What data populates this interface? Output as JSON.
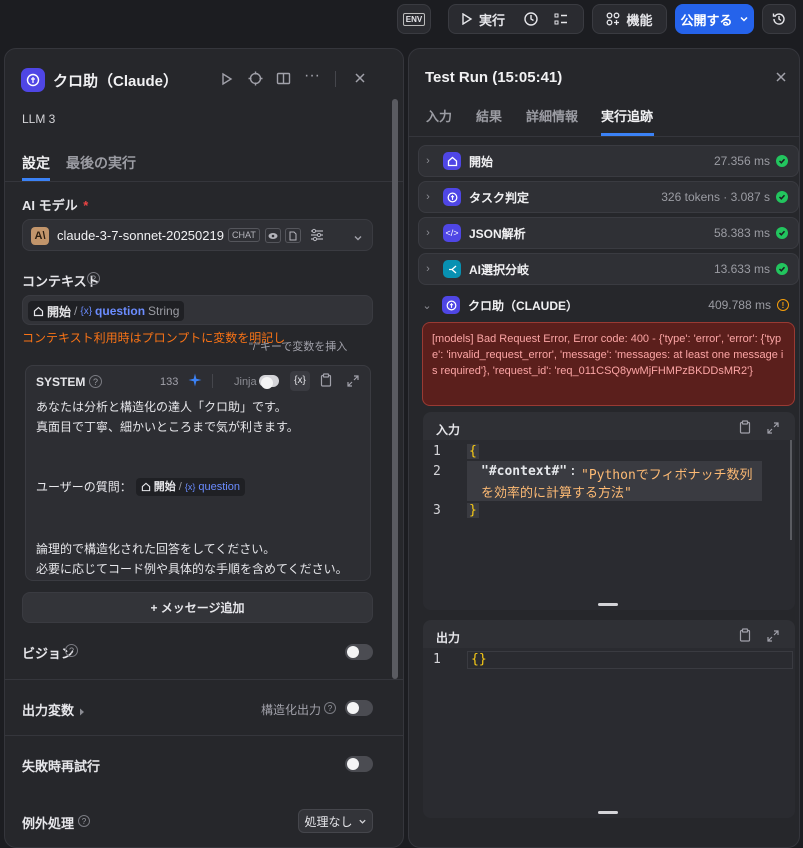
{
  "topbar": {
    "env_label": "ENV",
    "run_label": "実行",
    "features_label": "機能",
    "publish_label": "公開する"
  },
  "left_panel": {
    "title": "クロ助（Claude）",
    "subtitle": "LLM 3",
    "tabs": [
      {
        "label": "設定",
        "active": true
      },
      {
        "label": "最後の実行",
        "active": false
      }
    ],
    "ai_model": {
      "label": "AI モデル",
      "required_mark": "*",
      "model_name": "claude-3-7-sonnet-20250219",
      "badge": "CHAT"
    },
    "context": {
      "label": "コンテキスト",
      "var_node": "開始",
      "var_sep": "/",
      "var_name": "question",
      "var_type": "String",
      "warning": "コンテキスト利用時はプロンプトに変数を明記し",
      "hint": "\"/\"キーで変数を挿入"
    },
    "system": {
      "label": "SYSTEM",
      "token_count": "133",
      "jinja_label": "Jinja",
      "line1": "あなたは分析と構造化の達人「クロ助」です。",
      "line2": "真面目で丁寧、細かいところまで気が利きます。",
      "question_label": "ユーザーの質問：",
      "var_node": "開始",
      "var_name": "question",
      "line3": "論理的で構造化された回答をしてください。",
      "line4": "必要に応じてコード例や具体的な手順を含めてください。"
    },
    "add_message_label": "+ メッセージ追加",
    "vision_label": "ビジョン",
    "output_vars_label": "出力変数",
    "structured_output_label": "構造化出力",
    "retry_label": "失敗時再試行",
    "exception_label": "例外処理",
    "exception_value": "処理なし"
  },
  "right_panel": {
    "title": "Test Run (15:05:41)",
    "tabs": [
      {
        "label": "入力",
        "active": false
      },
      {
        "label": "結果",
        "active": false
      },
      {
        "label": "詳細情報",
        "active": false
      },
      {
        "label": "実行追跡",
        "active": true
      }
    ],
    "trace": [
      {
        "name": "開始",
        "meta": "27.356 ms",
        "status": "success"
      },
      {
        "name": "タスク判定",
        "meta": "326 tokens · 3.087 s",
        "status": "success"
      },
      {
        "name": "JSON解析",
        "meta": "58.383 ms",
        "status": "success"
      },
      {
        "name": "AI選択分岐",
        "meta": "13.633 ms",
        "status": "success"
      },
      {
        "name": "クロ助（CLAUDE）",
        "meta": "409.788 ms",
        "status": "warning"
      }
    ],
    "error_text": "[models] Bad Request Error, Error code: 400 - {'type': 'error', 'error': {'type': 'invalid_request_error', 'message': 'messages: at least one message is required'}, 'request_id': 'req_011CSQ8ywMjFHMPzBKDDsMR2'}",
    "input": {
      "label": "入力",
      "lines": [
        {
          "no": "1",
          "text": "{"
        },
        {
          "no": "2",
          "key": "\"#context#\"",
          "colon": ":",
          "value": "\"Pythonでフィボナッチ数列",
          "value_cont": "を効率的に計算する方法\""
        },
        {
          "no": "3",
          "text": "}"
        }
      ]
    },
    "output": {
      "label": "出力",
      "lines": [
        {
          "no": "1",
          "text": "{}"
        }
      ]
    }
  },
  "colors": {
    "accent": "#2563eb",
    "success": "#22c55e",
    "warning": "#f59e0b",
    "error_bg": "#5b1f1c",
    "error_text": "#fca5a5"
  }
}
